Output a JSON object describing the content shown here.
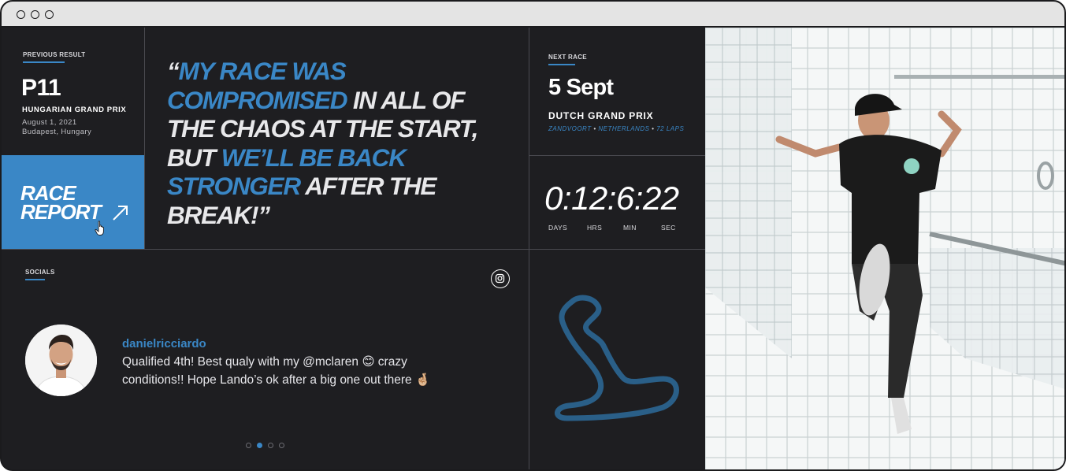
{
  "previous_result": {
    "eyebrow": "PREVIOUS RESULT",
    "position": "P11",
    "grand_prix": "HUNGARIAN GRAND PRIX",
    "date": "August 1, 2021",
    "location": "Budapest, Hungary"
  },
  "race_report": {
    "line1": "RACE",
    "line2": "REPORT"
  },
  "quote": {
    "open": "“",
    "part1_hl": "MY RACE WAS COMPROMISED",
    "part2": " IN ALL OF THE CHAOS AT THE START, BUT ",
    "part3_hl": "WE’LL BE BACK STRONGER",
    "part4": " AFTER THE BREAK!”"
  },
  "next_race": {
    "eyebrow": "NEXT RACE",
    "date": "5 Sept",
    "grand_prix": "DUTCH GRAND PRIX",
    "city": "ZANDVOORT",
    "country": "NETHERLANDS",
    "laps": "72 LAPS",
    "separator": "•"
  },
  "countdown": {
    "value": "0:12:6:22",
    "labels": [
      "DAYS",
      "HRS",
      "MIN",
      "SEC"
    ]
  },
  "socials": {
    "eyebrow": "SOCIALS",
    "handle": "danielricciardo",
    "post_text": "Qualified 4th! Best qualy with my @mclaren 😊 crazy conditions!! Hope Lando’s ok after a big one out there 🤞🏼",
    "pager": {
      "count": 4,
      "active_index": 1
    }
  },
  "icons": {
    "instagram": "instagram-icon",
    "report_arrow": "arrow-up-right-icon",
    "cursor": "hand-pointer-icon",
    "track": "track-map-icon"
  },
  "colors": {
    "accent": "#3a87c6",
    "background": "#1e1e21",
    "text": "#ffffff"
  }
}
